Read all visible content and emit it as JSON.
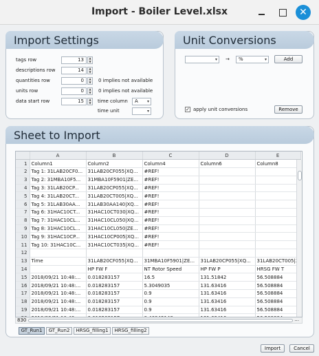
{
  "window": {
    "title": "Import - Boiler Level.xlsx",
    "close_glyph": "✕"
  },
  "import_settings": {
    "title": "Import Settings",
    "tags_row": {
      "label": "tags row",
      "value": "13"
    },
    "descriptions_row": {
      "label": "descriptions row",
      "value": "14"
    },
    "quantities_row": {
      "label": "quantities row",
      "value": "0",
      "note": "0 implies not available"
    },
    "units_row": {
      "label": "units row",
      "value": "0",
      "note": "0 implies not available"
    },
    "data_start_row": {
      "label": "data start row",
      "value": "15"
    },
    "time_column": {
      "label": "time column",
      "value": "A"
    },
    "time_unit": {
      "label": "time unit",
      "value": ""
    }
  },
  "unit_conversions": {
    "title": "Unit Conversions",
    "from_unit": "",
    "arrow": "→",
    "to_unit": "%",
    "add_label": "Add",
    "apply_label": "apply unit conversions",
    "apply_checked": "✓",
    "remove_label": "Remove"
  },
  "sheet": {
    "title": "Sheet to Import",
    "columns": [
      "A",
      "B",
      "C",
      "D",
      "E"
    ],
    "rows": [
      [
        "1",
        "Column1",
        "Column2",
        "Column4",
        "Column6",
        "Column8"
      ],
      [
        "2",
        "Tag 1: 31LAB20CF0...",
        "31LAB20CF055|XQ...",
        "#REF!",
        "",
        ""
      ],
      [
        "3",
        "Tag 2: 31MBA10F5...",
        "31MBA10F5901|ZE...",
        "#REF!",
        "",
        ""
      ],
      [
        "4",
        "Tag 3: 31LAB20CP...",
        "31LAB20CP055|XQ...",
        "#REF!",
        "",
        ""
      ],
      [
        "5",
        "Tag 4: 31LAB20CT...",
        "31LAB20CT005|XQ...",
        "#REF!",
        "",
        ""
      ],
      [
        "6",
        "Tag 5: 31LAB30AA...",
        "31LAB30AA140|XQ...",
        "#REF!",
        "",
        ""
      ],
      [
        "7",
        "Tag 6: 31HAC10CT...",
        "31HAC10CT030|XQ...",
        "#REF!",
        "",
        ""
      ],
      [
        "8",
        "Tag 7: 31HAC10CL...",
        "31HAC10CL050|XQ...",
        "#REF!",
        "",
        ""
      ],
      [
        "9",
        "Tag 8: 31HAC10CL...",
        "31HAC10CL050|ZE...",
        "#REF!",
        "",
        ""
      ],
      [
        "10",
        "Tag 9: 31HAC10CP...",
        "31HAC10CP005|XQ...",
        "#REF!",
        "",
        ""
      ],
      [
        "11",
        "Tag 10: 31HAC10C...",
        "31HAC10CT035|XQ...",
        "#REF!",
        "",
        ""
      ],
      [
        "12",
        "",
        "",
        "",
        "",
        ""
      ],
      [
        "13",
        "Time",
        "31LAB20CF055|XQ...",
        "31MBA10F5901|ZE...",
        "31LAB20CP055|XQ...",
        "31LAB20CT005|X"
      ],
      [
        "14",
        "",
        "HP FW F",
        "NT Rotor Speed",
        "HP FW P",
        "HRSG FW T"
      ],
      [
        "15",
        "2018/09/21 10:48:...",
        "0.018283157",
        "16.5",
        "131.51842",
        "56.508884"
      ],
      [
        "16",
        "2018/09/21 10:48:...",
        "0.018283157",
        "5.3049035",
        "131.63416",
        "56.508884"
      ],
      [
        "17",
        "2018/09/21 10:48:...",
        "0.018283157",
        "0.9",
        "131.63416",
        "56.508884"
      ],
      [
        "18",
        "2018/09/21 10:48:...",
        "0.018283157",
        "0.9",
        "131.63416",
        "56.508884"
      ],
      [
        "19",
        "2018/09/21 10:48:...",
        "0.018283157",
        "0.9",
        "131.63416",
        "56.508884"
      ],
      [
        "20",
        "2018/09/21 10:48:...",
        "0.018283157",
        "0.46942148",
        "131.63416",
        "56.508884"
      ]
    ],
    "row_count": "830",
    "more": "...",
    "tabs": [
      "GT_Run1",
      "GT_Run2",
      "HRSG_filling1",
      "HRSG_filling2"
    ]
  },
  "footer": {
    "import_label": "Import",
    "cancel_label": "Cancel"
  }
}
